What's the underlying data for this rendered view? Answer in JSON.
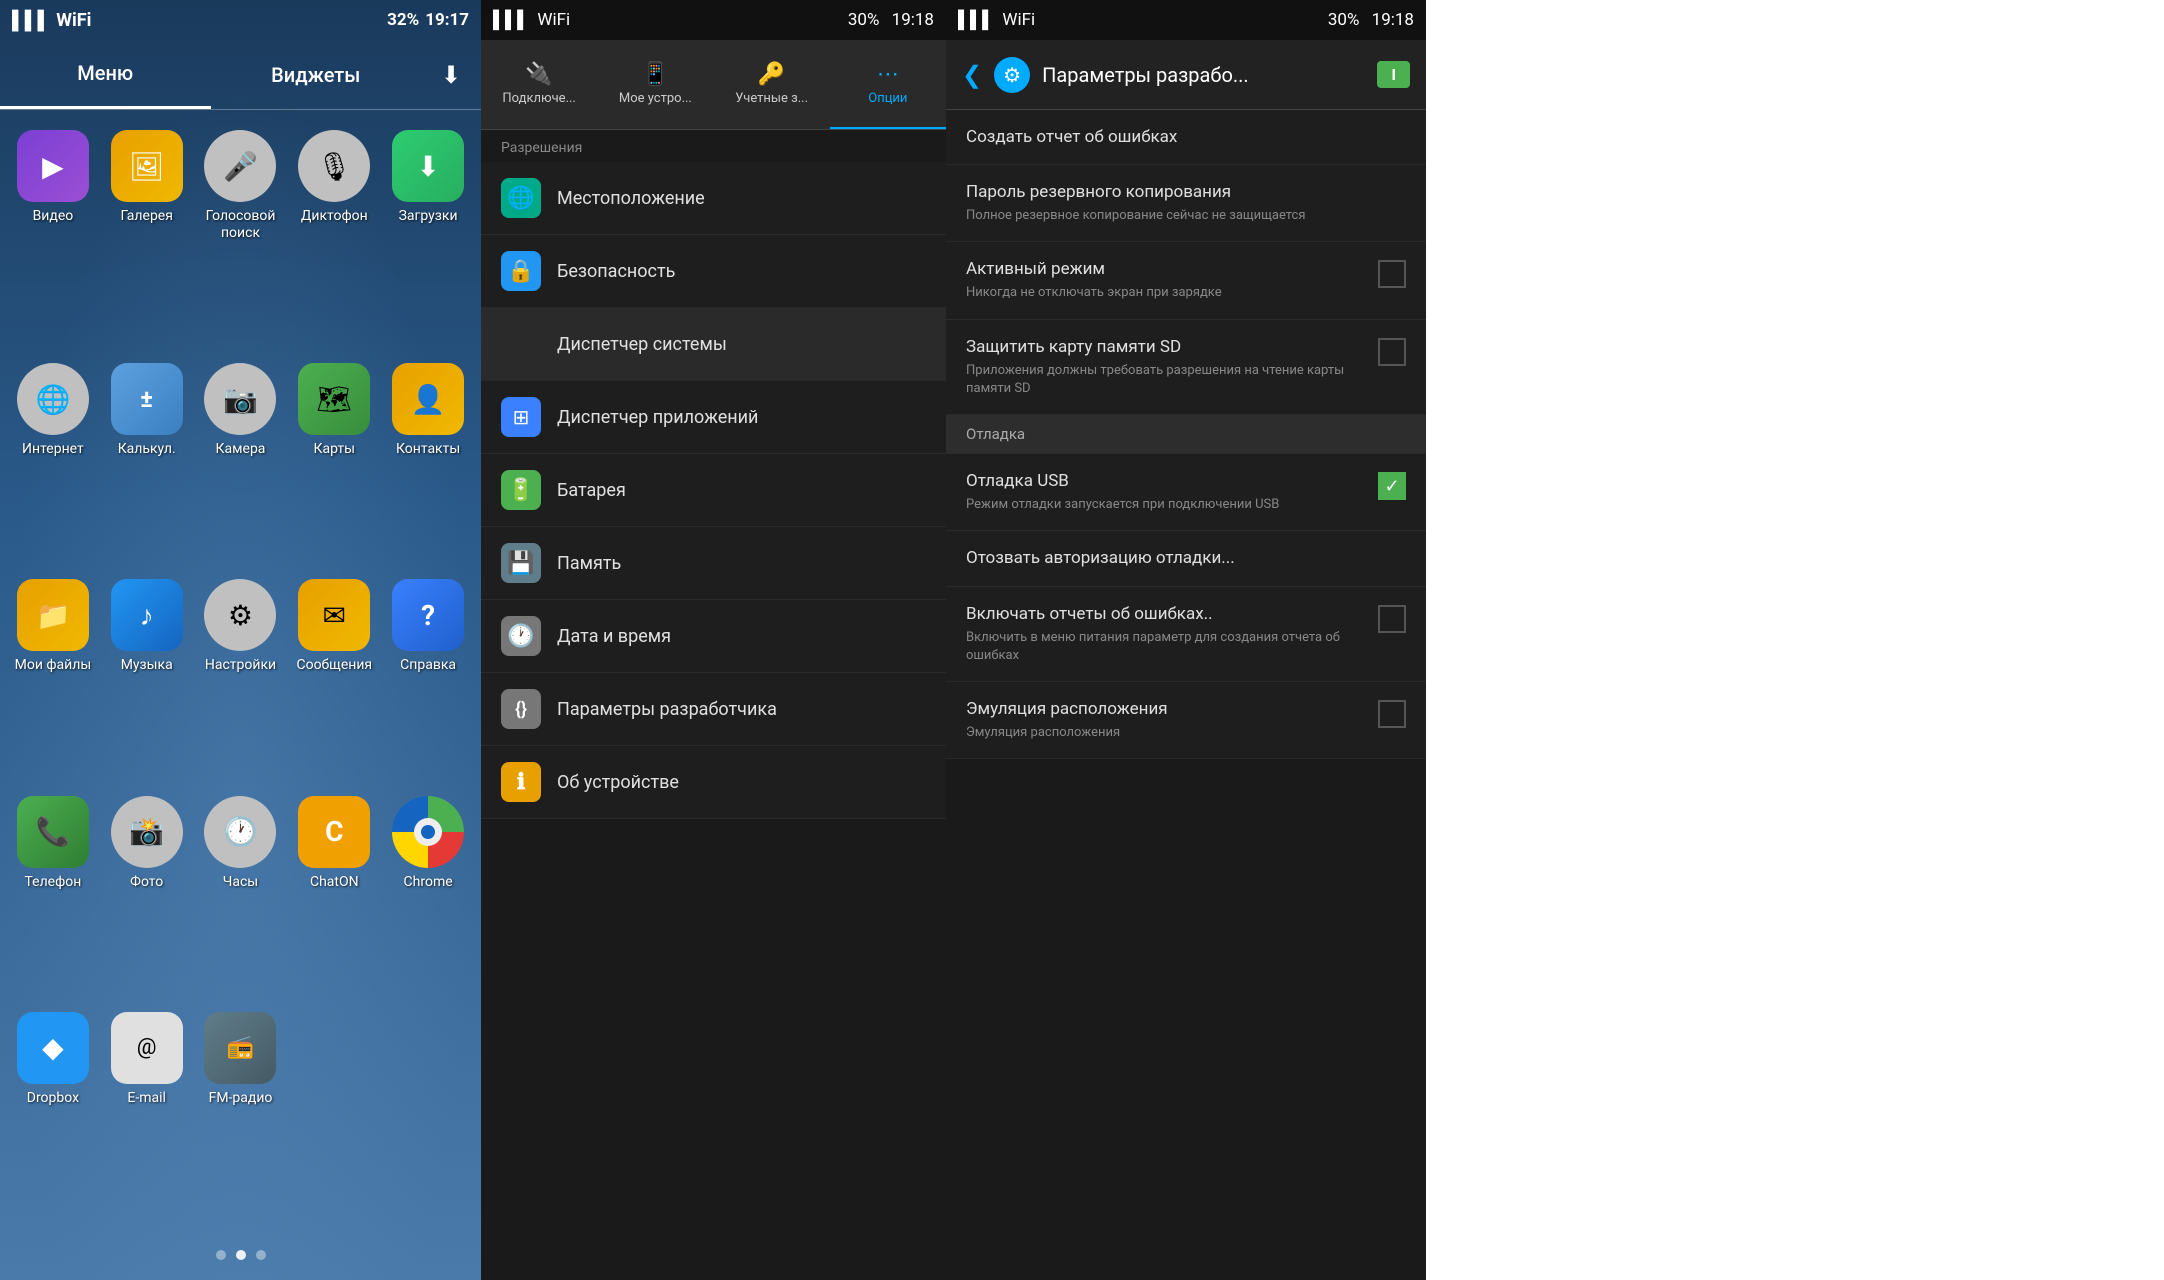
{
  "panel1": {
    "status_bar": {
      "signal": "▌▌▌",
      "wifi": "WiFi",
      "battery": "32%",
      "time": "19:17"
    },
    "tabs": [
      {
        "label": "Меню",
        "active": true
      },
      {
        "label": "Виджеты",
        "active": false
      }
    ],
    "download_icon": "⬇",
    "apps": [
      {
        "id": "video",
        "label": "Видео",
        "icon": "▶",
        "bg": "#7b3fd4"
      },
      {
        "id": "gallery",
        "label": "Галерея",
        "icon": "🖼",
        "bg": "#e8a000"
      },
      {
        "id": "voice",
        "label": "Голосовой поиск",
        "icon": "🎤",
        "bg": "#c0c0c0"
      },
      {
        "id": "dictophone",
        "label": "Диктофон",
        "icon": "🎙",
        "bg": "#c0c0c0"
      },
      {
        "id": "downloads",
        "label": "Загрузки",
        "icon": "⬇",
        "bg": "#27ae60"
      },
      {
        "id": "internet",
        "label": "Интернет",
        "icon": "🌐",
        "bg": "#c0c0c0"
      },
      {
        "id": "calc",
        "label": "Калькул.",
        "icon": "±",
        "bg": "#5da0e0"
      },
      {
        "id": "camera",
        "label": "Камера",
        "icon": "📷",
        "bg": "#c0c0c0"
      },
      {
        "id": "maps",
        "label": "Карты",
        "icon": "🗺",
        "bg": "#4CAF50"
      },
      {
        "id": "contacts",
        "label": "Контакты",
        "icon": "👤",
        "bg": "#e8a000"
      },
      {
        "id": "myfiles",
        "label": "Мои файлы",
        "icon": "📁",
        "bg": "#e8a000"
      },
      {
        "id": "music",
        "label": "Музыка",
        "icon": "♪",
        "bg": "#2196F3"
      },
      {
        "id": "settings",
        "label": "Настройки",
        "icon": "⚙",
        "bg": "#c0c0c0"
      },
      {
        "id": "messages",
        "label": "Сообщения",
        "icon": "✉",
        "bg": "#e8a000"
      },
      {
        "id": "help",
        "label": "Справка",
        "icon": "?",
        "bg": "#3a80ff"
      },
      {
        "id": "phone",
        "label": "Телефон",
        "icon": "📞",
        "bg": "#4CAF50"
      },
      {
        "id": "photos",
        "label": "Фото",
        "icon": "📸",
        "bg": "#c0c0c0"
      },
      {
        "id": "clock",
        "label": "Часы",
        "icon": "🕐",
        "bg": "#c0c0c0"
      },
      {
        "id": "chaton",
        "label": "ChatON",
        "icon": "C",
        "bg": "#f0a000"
      },
      {
        "id": "chrome",
        "label": "Chrome",
        "icon": "◎",
        "bg": "#4CAF50"
      },
      {
        "id": "dropbox",
        "label": "Dropbox",
        "icon": "◆",
        "bg": "#2196F3"
      },
      {
        "id": "email",
        "label": "E-mail",
        "icon": "@",
        "bg": "#e0e0e0"
      },
      {
        "id": "fm",
        "label": "FM-радио",
        "icon": "📻",
        "bg": "#607D8B"
      }
    ],
    "dots": [
      0,
      1,
      2
    ],
    "active_dot": 1
  },
  "panel2": {
    "status_bar": {
      "battery": "30%",
      "time": "19:18"
    },
    "tabs": [
      {
        "id": "connection",
        "label": "Подключе...",
        "icon": "🔌"
      },
      {
        "id": "device",
        "label": "Мое устро...",
        "icon": "📱"
      },
      {
        "id": "accounts",
        "label": "Учетные з...",
        "icon": "🔑"
      },
      {
        "id": "options",
        "label": "Опции",
        "icon": "⋯",
        "active": true
      }
    ],
    "section_label": "Разрешения",
    "items": [
      {
        "id": "location",
        "label": "Местоположение",
        "icon": "🌐",
        "icon_bg": "#00aa88"
      },
      {
        "id": "security",
        "label": "Безопасность",
        "icon": "🔒",
        "icon_bg": "#2196F3"
      },
      {
        "id": "system_manager",
        "label": "Диспетчер системы",
        "icon": "",
        "icon_bg": "transparent",
        "highlighted": true
      },
      {
        "id": "app_manager",
        "label": "Диспетчер приложений",
        "icon": "⊞",
        "icon_bg": "#3a80ff"
      },
      {
        "id": "battery",
        "label": "Батарея",
        "icon": "🔋",
        "icon_bg": "#4CAF50"
      },
      {
        "id": "memory",
        "label": "Память",
        "icon": "💾",
        "icon_bg": "#607D8B"
      },
      {
        "id": "datetime",
        "label": "Дата и время",
        "icon": "🕐",
        "icon_bg": "#888"
      },
      {
        "id": "devtools",
        "label": "Параметры разработчика",
        "icon": "{}",
        "icon_bg": "#888"
      },
      {
        "id": "about",
        "label": "Об устройстве",
        "icon": "ℹ",
        "icon_bg": "#e8a000"
      }
    ]
  },
  "panel3": {
    "status_bar": {
      "battery": "30%",
      "time": "19:18"
    },
    "header": {
      "title": "Параметры разрабо...",
      "toggle_label": "I"
    },
    "items": [
      {
        "id": "bug_report",
        "title": "Создать отчет об ошибках",
        "desc": "",
        "has_checkbox": false,
        "checked": false,
        "section": false
      },
      {
        "id": "backup_pass",
        "title": "Пароль резервного копирования",
        "desc": "Полное резервное копирование сейчас не защищается",
        "has_checkbox": false,
        "checked": false,
        "section": false
      },
      {
        "id": "active_mode",
        "title": "Активный режим",
        "desc": "Никогда не отключать экран при зарядке",
        "has_checkbox": true,
        "checked": false,
        "section": false
      },
      {
        "id": "protect_sd",
        "title": "Защитить карту памяти SD",
        "desc": "Приложения должны требовать разрешения на чтение карты памяти SD",
        "has_checkbox": true,
        "checked": false,
        "section": false
      },
      {
        "id": "debug_section",
        "title": "Отладка",
        "desc": "",
        "has_checkbox": false,
        "checked": false,
        "section": true
      },
      {
        "id": "usb_debug",
        "title": "Отладка USB",
        "desc": "Режим отладки запускается при подключении USB",
        "has_checkbox": true,
        "checked": true,
        "section": false
      },
      {
        "id": "revoke_debug",
        "title": "Отозвать авторизацию отладки...",
        "desc": "",
        "has_checkbox": false,
        "checked": false,
        "section": false
      },
      {
        "id": "error_reports",
        "title": "Включать отчеты об ошибках..",
        "desc": "Включить в меню питания параметр для создания отчета об ошибках",
        "has_checkbox": true,
        "checked": false,
        "section": false
      },
      {
        "id": "mock_location",
        "title": "Эмуляция расположения",
        "desc": "Эмуляция расположения",
        "has_checkbox": true,
        "checked": false,
        "section": false
      }
    ]
  },
  "icons": {
    "back_arrow": "❮",
    "settings_gear": "⚙",
    "wifi": "WiFi",
    "signal": "▌",
    "battery_full": "🔋",
    "checkmark": "✓"
  }
}
